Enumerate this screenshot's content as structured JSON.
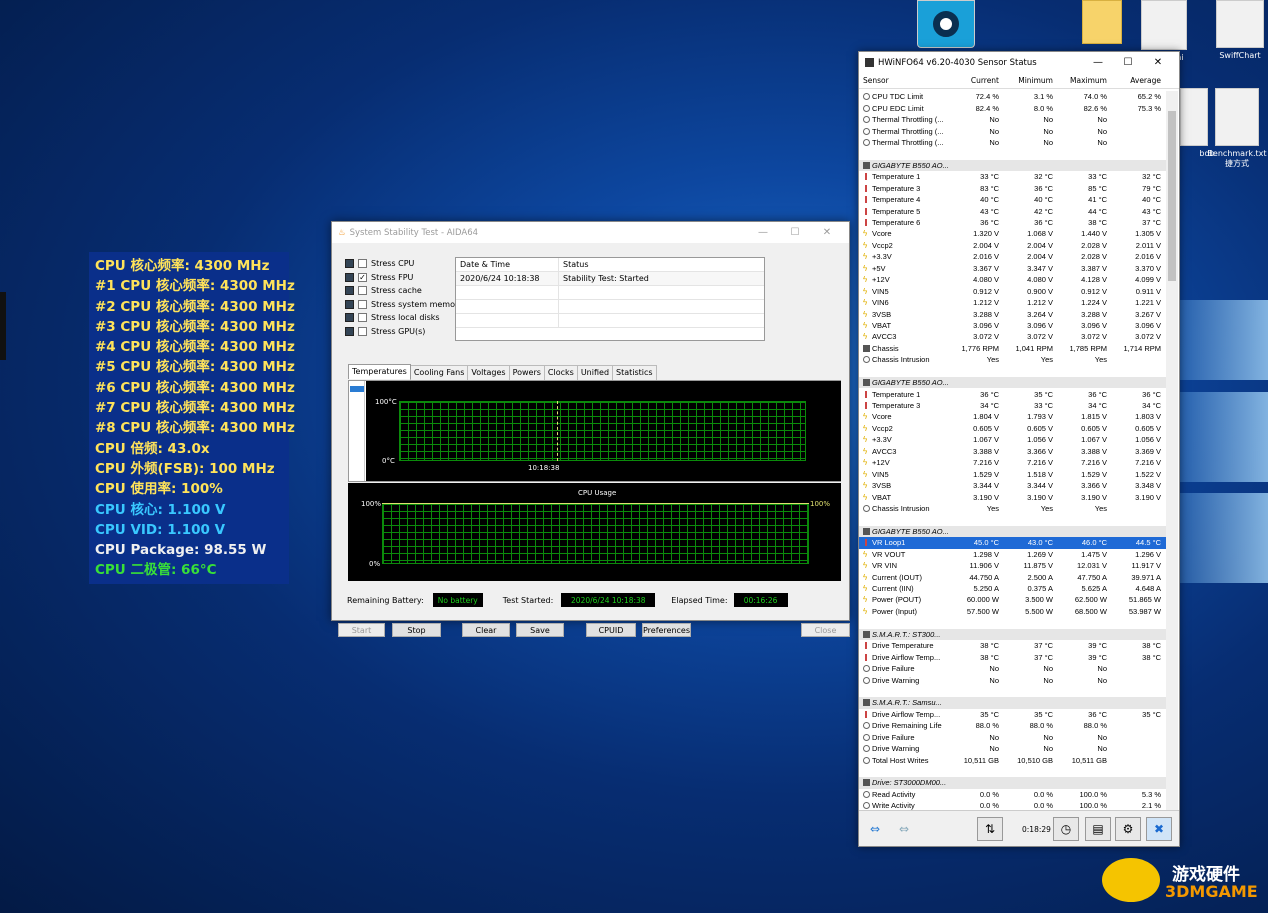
{
  "desktop": {
    "icons": [
      {
        "label": "g.ini"
      },
      {
        "label": "SwiffChart"
      },
      {
        "label": "bdb"
      },
      {
        "label": "Benchmark.txt\n捷方式"
      }
    ]
  },
  "osd": {
    "lines": [
      {
        "text": "CPU 核心频率: 4300 MHz",
        "color": "#ffe35a"
      },
      {
        "text": "#1 CPU 核心频率: 4300 MHz",
        "color": "#ffe35a"
      },
      {
        "text": "#2 CPU 核心频率: 4300 MHz",
        "color": "#ffe35a"
      },
      {
        "text": "#3 CPU 核心频率: 4300 MHz",
        "color": "#ffe35a"
      },
      {
        "text": "#4 CPU 核心频率: 4300 MHz",
        "color": "#ffe35a"
      },
      {
        "text": "#5 CPU 核心频率: 4300 MHz",
        "color": "#ffe35a"
      },
      {
        "text": "#6 CPU 核心频率: 4300 MHz",
        "color": "#ffe35a"
      },
      {
        "text": "#7 CPU 核心频率: 4300 MHz",
        "color": "#ffe35a"
      },
      {
        "text": "#8 CPU 核心频率: 4300 MHz",
        "color": "#ffe35a"
      },
      {
        "text": "CPU 倍频: 43.0x",
        "color": "#ffe35a"
      },
      {
        "text": "CPU 外频(FSB): 100 MHz",
        "color": "#ffe35a"
      },
      {
        "text": "CPU 使用率: 100%",
        "color": "#ffe35a"
      },
      {
        "text": "CPU 核心: 1.100 V",
        "color": "#39c8ff"
      },
      {
        "text": "CPU VID: 1.100 V",
        "color": "#39c8ff"
      },
      {
        "text": "CPU Package: 98.55 W",
        "color": "#f0f0f0"
      },
      {
        "text": "CPU 二极管: 66°C",
        "color": "#38e038"
      }
    ]
  },
  "aida": {
    "title": "System Stability Test - AIDA64",
    "stress": [
      {
        "label": "Stress CPU",
        "checked": ""
      },
      {
        "label": "Stress FPU",
        "checked": "✓"
      },
      {
        "label": "Stress cache",
        "checked": ""
      },
      {
        "label": "Stress system memory",
        "checked": ""
      },
      {
        "label": "Stress local disks",
        "checked": ""
      },
      {
        "label": "Stress GPU(s)",
        "checked": ""
      }
    ],
    "status": {
      "col1": "Date & Time",
      "col2": "Status",
      "row_date": "2020/6/24 10:18:38",
      "row_status": "Stability Test: Started"
    },
    "tabs": [
      "Temperatures",
      "Cooling Fans",
      "Voltages",
      "Powers",
      "Clocks",
      "Unified",
      "Statistics"
    ],
    "temp_graph": {
      "top": "100°C",
      "bottom": "0°C",
      "time": "10:18:38"
    },
    "cpu_graph": {
      "title": "CPU Usage",
      "left_top": "100%",
      "left_bottom": "0%",
      "right_top": "100%"
    },
    "battery_label": "Remaining Battery:",
    "battery_value": "No battery",
    "started_label": "Test Started:",
    "started_value": "2020/6/24 10:18:38",
    "elapsed_label": "Elapsed Time:",
    "elapsed_value": "00:16:26",
    "buttons": {
      "start": "Start",
      "stop": "Stop",
      "clear": "Clear",
      "save": "Save",
      "cpuid": "CPUID",
      "preferences": "Preferences",
      "close": "Close"
    }
  },
  "hwinfo": {
    "title": "HWiNFO64 v6.20-4030 Sensor Status",
    "columns": [
      "Sensor",
      "Current",
      "Minimum",
      "Maximum",
      "Average"
    ],
    "rows": [
      {
        "t": "dot",
        "n": "CPU TDC Limit",
        "c": "72.4 %",
        "mi": "3.1 %",
        "ma": "74.0 %",
        "a": "65.2 %"
      },
      {
        "t": "dot",
        "n": "CPU EDC Limit",
        "c": "82.4 %",
        "mi": "8.0 %",
        "ma": "82.6 %",
        "a": "75.3 %"
      },
      {
        "t": "dot",
        "n": "Thermal Throttling (...",
        "c": "No",
        "mi": "No",
        "ma": "No",
        "a": ""
      },
      {
        "t": "dot",
        "n": "Thermal Throttling (...",
        "c": "No",
        "mi": "No",
        "ma": "No",
        "a": ""
      },
      {
        "t": "dot",
        "n": "Thermal Throttling (...",
        "c": "No",
        "mi": "No",
        "ma": "No",
        "a": ""
      },
      {
        "t": "blank"
      },
      {
        "t": "group",
        "n": "GIGABYTE B550 AO..."
      },
      {
        "t": "temp",
        "n": "Temperature 1",
        "c": "33 °C",
        "mi": "32 °C",
        "ma": "33 °C",
        "a": "32 °C"
      },
      {
        "t": "temp",
        "n": "Temperature 3",
        "c": "83 °C",
        "mi": "36 °C",
        "ma": "85 °C",
        "a": "79 °C"
      },
      {
        "t": "temp",
        "n": "Temperature 4",
        "c": "40 °C",
        "mi": "40 °C",
        "ma": "41 °C",
        "a": "40 °C"
      },
      {
        "t": "temp",
        "n": "Temperature 5",
        "c": "43 °C",
        "mi": "42 °C",
        "ma": "44 °C",
        "a": "43 °C"
      },
      {
        "t": "temp",
        "n": "Temperature 6",
        "c": "36 °C",
        "mi": "36 °C",
        "ma": "38 °C",
        "a": "37 °C"
      },
      {
        "t": "volt",
        "n": "Vcore",
        "c": "1.320 V",
        "mi": "1.068 V",
        "ma": "1.440 V",
        "a": "1.305 V"
      },
      {
        "t": "volt",
        "n": "Vccp2",
        "c": "2.004 V",
        "mi": "2.004 V",
        "ma": "2.028 V",
        "a": "2.011 V"
      },
      {
        "t": "volt",
        "n": "+3.3V",
        "c": "2.016 V",
        "mi": "2.004 V",
        "ma": "2.028 V",
        "a": "2.016 V"
      },
      {
        "t": "volt",
        "n": "+5V",
        "c": "3.367 V",
        "mi": "3.347 V",
        "ma": "3.387 V",
        "a": "3.370 V"
      },
      {
        "t": "volt",
        "n": "+12V",
        "c": "4.080 V",
        "mi": "4.080 V",
        "ma": "4.128 V",
        "a": "4.099 V"
      },
      {
        "t": "volt",
        "n": "VIN5",
        "c": "0.912 V",
        "mi": "0.900 V",
        "ma": "0.912 V",
        "a": "0.911 V"
      },
      {
        "t": "volt",
        "n": "VIN6",
        "c": "1.212 V",
        "mi": "1.212 V",
        "ma": "1.224 V",
        "a": "1.221 V"
      },
      {
        "t": "volt",
        "n": "3VSB",
        "c": "3.288 V",
        "mi": "3.264 V",
        "ma": "3.288 V",
        "a": "3.267 V"
      },
      {
        "t": "volt",
        "n": "VBAT",
        "c": "3.096 V",
        "mi": "3.096 V",
        "ma": "3.096 V",
        "a": "3.096 V"
      },
      {
        "t": "volt",
        "n": "AVCC3",
        "c": "3.072 V",
        "mi": "3.072 V",
        "ma": "3.072 V",
        "a": "3.072 V"
      },
      {
        "t": "chip",
        "n": "Chassis",
        "c": "1,776 RPM",
        "mi": "1,041 RPM",
        "ma": "1,785 RPM",
        "a": "1,714 RPM"
      },
      {
        "t": "dot",
        "n": "Chassis Intrusion",
        "c": "Yes",
        "mi": "Yes",
        "ma": "Yes",
        "a": ""
      },
      {
        "t": "blank"
      },
      {
        "t": "group",
        "n": "GIGABYTE B550 AO..."
      },
      {
        "t": "temp",
        "n": "Temperature 1",
        "c": "36 °C",
        "mi": "35 °C",
        "ma": "36 °C",
        "a": "36 °C"
      },
      {
        "t": "temp",
        "n": "Temperature 3",
        "c": "34 °C",
        "mi": "33 °C",
        "ma": "34 °C",
        "a": "34 °C"
      },
      {
        "t": "volt",
        "n": "Vcore",
        "c": "1.804 V",
        "mi": "1.793 V",
        "ma": "1.815 V",
        "a": "1.803 V"
      },
      {
        "t": "volt",
        "n": "Vccp2",
        "c": "0.605 V",
        "mi": "0.605 V",
        "ma": "0.605 V",
        "a": "0.605 V"
      },
      {
        "t": "volt",
        "n": "+3.3V",
        "c": "1.067 V",
        "mi": "1.056 V",
        "ma": "1.067 V",
        "a": "1.056 V"
      },
      {
        "t": "volt",
        "n": "AVCC3",
        "c": "3.388 V",
        "mi": "3.366 V",
        "ma": "3.388 V",
        "a": "3.369 V"
      },
      {
        "t": "volt",
        "n": "+12V",
        "c": "7.216 V",
        "mi": "7.216 V",
        "ma": "7.216 V",
        "a": "7.216 V"
      },
      {
        "t": "volt",
        "n": "VIN5",
        "c": "1.529 V",
        "mi": "1.518 V",
        "ma": "1.529 V",
        "a": "1.522 V"
      },
      {
        "t": "volt",
        "n": "3VSB",
        "c": "3.344 V",
        "mi": "3.344 V",
        "ma": "3.366 V",
        "a": "3.348 V"
      },
      {
        "t": "volt",
        "n": "VBAT",
        "c": "3.190 V",
        "mi": "3.190 V",
        "ma": "3.190 V",
        "a": "3.190 V"
      },
      {
        "t": "dot",
        "n": "Chassis Intrusion",
        "c": "Yes",
        "mi": "Yes",
        "ma": "Yes",
        "a": ""
      },
      {
        "t": "blank"
      },
      {
        "t": "group",
        "n": "GIGABYTE B550 AO..."
      },
      {
        "t": "sel",
        "n": "VR Loop1",
        "c": "45.0 °C",
        "mi": "43.0 °C",
        "ma": "46.0 °C",
        "a": "44.5 °C"
      },
      {
        "t": "volt",
        "n": "VR VOUT",
        "c": "1.298 V",
        "mi": "1.269 V",
        "ma": "1.475 V",
        "a": "1.296 V"
      },
      {
        "t": "volt",
        "n": "VR VIN",
        "c": "11.906 V",
        "mi": "11.875 V",
        "ma": "12.031 V",
        "a": "11.917 V"
      },
      {
        "t": "volt",
        "n": "Current (IOUT)",
        "c": "44.750 A",
        "mi": "2.500 A",
        "ma": "47.750 A",
        "a": "39.971 A"
      },
      {
        "t": "volt",
        "n": "Current (IIN)",
        "c": "5.250 A",
        "mi": "0.375 A",
        "ma": "5.625 A",
        "a": "4.648 A"
      },
      {
        "t": "volt",
        "n": "Power (POUT)",
        "c": "60.000 W",
        "mi": "3.500 W",
        "ma": "62.500 W",
        "a": "51.865 W"
      },
      {
        "t": "volt",
        "n": "Power (Input)",
        "c": "57.500 W",
        "mi": "5.500 W",
        "ma": "68.500 W",
        "a": "53.987 W"
      },
      {
        "t": "blank"
      },
      {
        "t": "group",
        "n": "S.M.A.R.T.: ST300..."
      },
      {
        "t": "temp",
        "n": "Drive Temperature",
        "c": "38 °C",
        "mi": "37 °C",
        "ma": "39 °C",
        "a": "38 °C"
      },
      {
        "t": "temp",
        "n": "Drive Airflow Temp...",
        "c": "38 °C",
        "mi": "37 °C",
        "ma": "39 °C",
        "a": "38 °C"
      },
      {
        "t": "dot",
        "n": "Drive Failure",
        "c": "No",
        "mi": "No",
        "ma": "No",
        "a": ""
      },
      {
        "t": "dot",
        "n": "Drive Warning",
        "c": "No",
        "mi": "No",
        "ma": "No",
        "a": ""
      },
      {
        "t": "blank"
      },
      {
        "t": "group",
        "n": "S.M.A.R.T.: Samsu..."
      },
      {
        "t": "temp",
        "n": "Drive Airflow Temp...",
        "c": "35 °C",
        "mi": "35 °C",
        "ma": "36 °C",
        "a": "35 °C"
      },
      {
        "t": "dot",
        "n": "Drive Remaining Life",
        "c": "88.0 %",
        "mi": "88.0 %",
        "ma": "88.0 %",
        "a": ""
      },
      {
        "t": "dot",
        "n": "Drive Failure",
        "c": "No",
        "mi": "No",
        "ma": "No",
        "a": ""
      },
      {
        "t": "dot",
        "n": "Drive Warning",
        "c": "No",
        "mi": "No",
        "ma": "No",
        "a": ""
      },
      {
        "t": "dot",
        "n": "Total Host Writes",
        "c": "10,511 GB",
        "mi": "10,510 GB",
        "ma": "10,511 GB",
        "a": ""
      },
      {
        "t": "blank"
      },
      {
        "t": "group",
        "n": "Drive: ST3000DM00..."
      },
      {
        "t": "dot",
        "n": "Read Activity",
        "c": "0.0 %",
        "mi": "0.0 %",
        "ma": "100.0 %",
        "a": "5.3 %"
      },
      {
        "t": "dot",
        "n": "Write Activity",
        "c": "0.0 %",
        "mi": "0.0 %",
        "ma": "100.0 %",
        "a": "2.1 %"
      }
    ],
    "timer": "0:18:29"
  },
  "watermark": {
    "cn": "游戏硬件",
    "en": "3DMGAME"
  }
}
